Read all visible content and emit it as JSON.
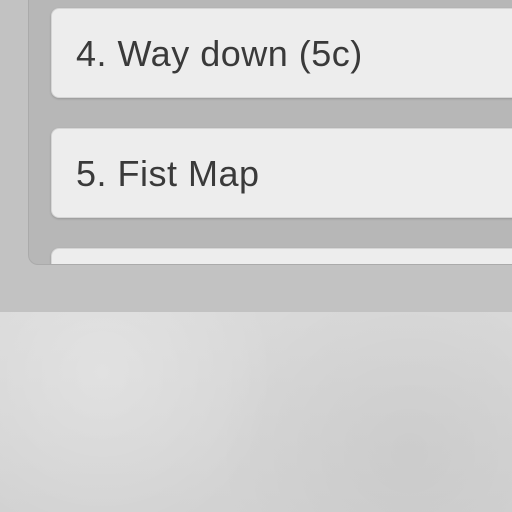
{
  "routes": {
    "items": [
      {
        "label": "4. Way down (5c)"
      },
      {
        "label": "5. Fist Map"
      },
      {
        "label": ""
      }
    ]
  }
}
